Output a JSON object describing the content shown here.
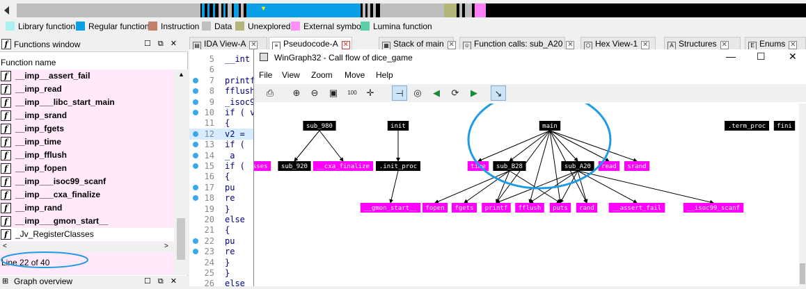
{
  "navbar": {
    "colors": {
      "library": "#aaf0f0",
      "regular": "#0aa0e8",
      "instruction": "#c0806a",
      "data": "#c0c0c0",
      "unexplored": "#b5b57a",
      "external": "#ff80f8",
      "lumina": "#5ad0a8"
    }
  },
  "legend": [
    {
      "label": "Library function",
      "color": "#aaf0f0"
    },
    {
      "label": "Regular function",
      "color": "#0aa0e8"
    },
    {
      "label": "Instruction",
      "color": "#c0806a"
    },
    {
      "label": "Data",
      "color": "#c0c0c0"
    },
    {
      "label": "Unexplored",
      "color": "#b5b57a"
    },
    {
      "label": "External symbol",
      "color": "#ff90f8"
    },
    {
      "label": "Lumina function",
      "color": "#5ad0a8"
    }
  ],
  "functions_window": {
    "title": "Functions window",
    "column_header": "Function name",
    "items": [
      "__imp__assert_fail",
      "__imp_read",
      "__imp___libc_start_main",
      "__imp_srand",
      "__imp_fgets",
      "__imp_time",
      "__imp_fflush",
      "__imp_fopen",
      "__imp___isoc99_scanf",
      "__imp___cxa_finalize",
      "__imp_rand",
      "__imp___gmon_start__",
      "_Jv_RegisterClasses"
    ],
    "status": "Line 22 of 40"
  },
  "graph_overview": {
    "title": "Graph overview"
  },
  "tabs": [
    "IDA View-A",
    "Pseudocode-A",
    "Stack of main",
    "Function calls: sub_A20",
    "Hex View-1",
    "Structures",
    "Enums"
  ],
  "code": {
    "lines": [
      {
        "n": "5",
        "src": "__int",
        "dot": false
      },
      {
        "n": "6",
        "src": "",
        "dot": false
      },
      {
        "n": "7",
        "src": "printf",
        "dot": true
      },
      {
        "n": "8",
        "src": "fflush",
        "dot": true
      },
      {
        "n": "9",
        "src": "_isoc9",
        "dot": true
      },
      {
        "n": "10",
        "src": "if ( v",
        "dot": true
      },
      {
        "n": "11",
        "src": "{",
        "dot": false
      },
      {
        "n": "12",
        "src": "  v2 =",
        "dot": true
      },
      {
        "n": "13",
        "src": "  if (",
        "dot": true
      },
      {
        "n": "14",
        "src": "    _a",
        "dot": true
      },
      {
        "n": "15",
        "src": "  if (",
        "dot": true
      },
      {
        "n": "16",
        "src": "  {",
        "dot": false
      },
      {
        "n": "17",
        "src": "    pu",
        "dot": true
      },
      {
        "n": "18",
        "src": "    re",
        "dot": true
      },
      {
        "n": "19",
        "src": "  }",
        "dot": false
      },
      {
        "n": "20",
        "src": "  else",
        "dot": false
      },
      {
        "n": "21",
        "src": "  {",
        "dot": false
      },
      {
        "n": "22",
        "src": "    pu",
        "dot": true
      },
      {
        "n": "23",
        "src": "    re",
        "dot": true
      },
      {
        "n": "24",
        "src": "  }",
        "dot": false
      },
      {
        "n": "25",
        "src": "}",
        "dot": false
      },
      {
        "n": "26",
        "src": "else",
        "dot": false
      }
    ]
  },
  "wingraph": {
    "title": "WinGraph32 - Call flow of dice_game",
    "menu": [
      "File",
      "View",
      "Zoom",
      "Move",
      "Help"
    ],
    "controls": {
      "minimize": "—",
      "maximize": "☐",
      "close": "✕"
    },
    "toolbar": [
      "print",
      "zoom-in",
      "zoom-out",
      "fit",
      "100%",
      "center",
      "layout",
      "circle",
      "prev",
      "reload",
      "next",
      "select"
    ],
    "nodes": [
      {
        "id": "sub_980",
        "label": "sub_980",
        "ext": false
      },
      {
        "id": "init",
        "label": "init",
        "ext": false
      },
      {
        "id": "main",
        "label": "main",
        "ext": false
      },
      {
        "id": "term_proc",
        "label": ".term_proc",
        "ext": false
      },
      {
        "id": "fini",
        "label": "fini",
        "ext": false
      },
      {
        "id": "asses",
        "label": "asses",
        "ext": true
      },
      {
        "id": "sub_920",
        "label": "sub_920",
        "ext": false
      },
      {
        "id": "cxa_finalize",
        "label": "__cxa_finalize",
        "ext": true
      },
      {
        "id": "init_proc",
        "label": ".init_proc",
        "ext": false
      },
      {
        "id": "time",
        "label": "time",
        "ext": true
      },
      {
        "id": "sub_B28",
        "label": "sub_B28",
        "ext": false
      },
      {
        "id": "sub_A20",
        "label": "sub_A20",
        "ext": false
      },
      {
        "id": "read",
        "label": "read",
        "ext": true
      },
      {
        "id": "srand",
        "label": "srand",
        "ext": true
      },
      {
        "id": "gmon_start",
        "label": "__gmon_start__",
        "ext": true
      },
      {
        "id": "fopen",
        "label": "fopen",
        "ext": true
      },
      {
        "id": "fgets",
        "label": "fgets",
        "ext": true
      },
      {
        "id": "printf",
        "label": "printf",
        "ext": true
      },
      {
        "id": "fflush",
        "label": "fflush",
        "ext": true
      },
      {
        "id": "puts",
        "label": "puts",
        "ext": true
      },
      {
        "id": "rand",
        "label": "rand",
        "ext": true
      },
      {
        "id": "assert_fail",
        "label": "__assert_fail",
        "ext": true
      },
      {
        "id": "isoc99_scanf",
        "label": "__isoc99_scanf",
        "ext": true
      }
    ],
    "edges": [
      [
        "sub_980",
        "sub_920"
      ],
      [
        "sub_980",
        "cxa_finalize"
      ],
      [
        "init",
        "init_proc"
      ],
      [
        "init_proc",
        "gmon_start"
      ],
      [
        "main",
        "time"
      ],
      [
        "main",
        "sub_B28"
      ],
      [
        "main",
        "sub_A20"
      ],
      [
        "main",
        "read"
      ],
      [
        "main",
        "srand"
      ],
      [
        "main",
        "printf"
      ],
      [
        "main",
        "fflush"
      ],
      [
        "main",
        "puts"
      ],
      [
        "main",
        "rand"
      ],
      [
        "sub_B28",
        "fopen"
      ],
      [
        "sub_B28",
        "fgets"
      ],
      [
        "sub_B28",
        "printf"
      ],
      [
        "sub_B28",
        "puts"
      ],
      [
        "sub_A20",
        "printf"
      ],
      [
        "sub_A20",
        "fflush"
      ],
      [
        "sub_A20",
        "puts"
      ],
      [
        "sub_A20",
        "rand"
      ],
      [
        "sub_A20",
        "assert_fail"
      ],
      [
        "sub_A20",
        "isoc99_scanf"
      ]
    ],
    "node_color": "#000000",
    "ext_color": "#ff00ff",
    "annotation_color": "#1f9be6"
  }
}
